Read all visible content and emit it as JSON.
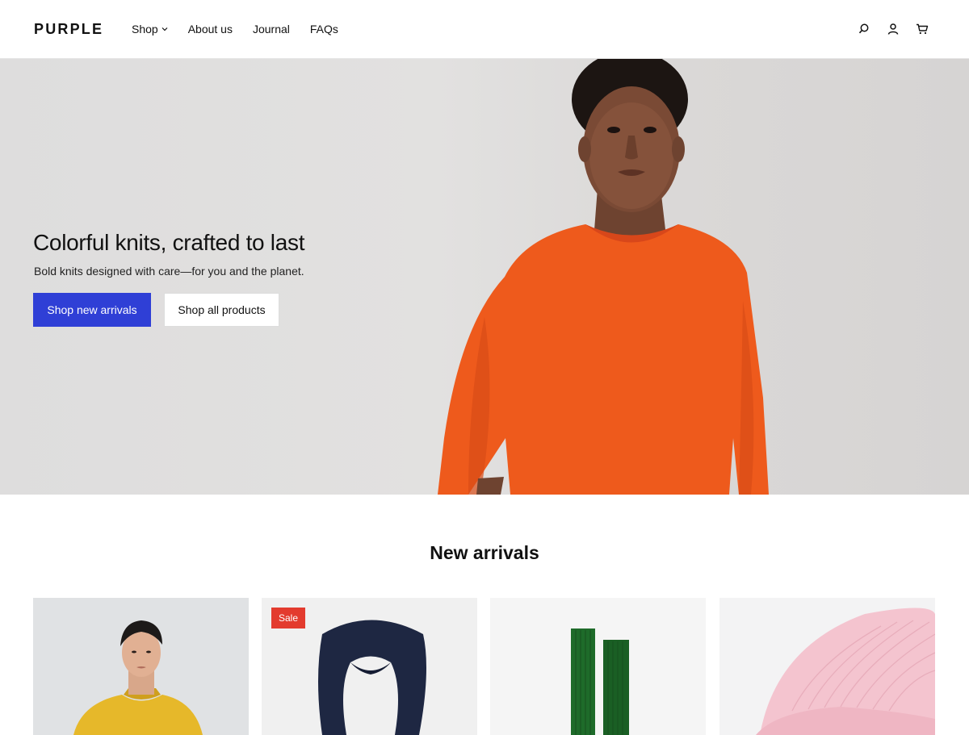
{
  "brand": "PURPLE",
  "nav": {
    "items": [
      {
        "label": "Shop"
      },
      {
        "label": "About us"
      },
      {
        "label": "Journal"
      },
      {
        "label": "FAQs"
      }
    ]
  },
  "header_icons": [
    "search-icon",
    "account-icon",
    "cart-icon"
  ],
  "hero": {
    "title": "Colorful knits, crafted to last",
    "subtitle": "Bold knits designed with care—for you and the planet.",
    "primary_cta": "Shop new arrivals",
    "secondary_cta": "Shop all products"
  },
  "new_arrivals": {
    "title": "New arrivals",
    "products": [
      {
        "badge": ""
      },
      {
        "badge": "Sale"
      },
      {
        "badge": ""
      },
      {
        "badge": ""
      }
    ]
  },
  "colors": {
    "accent": "#2f3fd6",
    "sale": "#e33b2e",
    "sweater_orange": "#ee5a1c"
  }
}
